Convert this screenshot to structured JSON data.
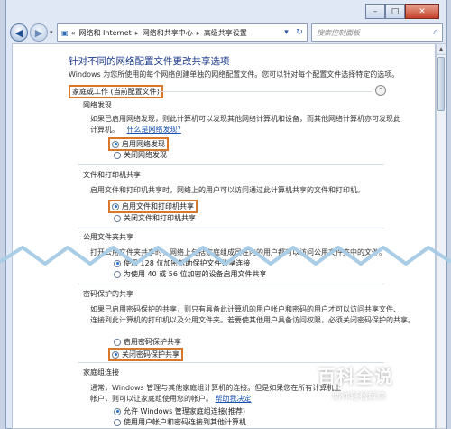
{
  "window": {
    "caption": {
      "minimize": "–",
      "maximize": "□",
      "close": "✕"
    }
  },
  "nav": {
    "back": "◀",
    "forward": "▶",
    "dropdown": "▾",
    "breadcrumbs": [
      "网络和 Internet",
      "网络和共享中心",
      "高级共享设置"
    ],
    "crumb_sep": "▸",
    "overflow": "«",
    "addr_dropdown": "▾",
    "refresh": "↻",
    "search_placeholder": "搜索控制面板",
    "search_icon": "magnifier-icon"
  },
  "page": {
    "title": "针对不同的网络配置文件更改共享选项",
    "description": "Windows 为您所使用的每个网络创建单独的网络配置文件。您可以针对每个配置文件选择特定的选项。",
    "group_label": "家庭或工作 (当前配置文件)",
    "group_chevron": "⌃",
    "sections": {
      "discovery": {
        "heading": "网络发现",
        "text1": "如果已启用网络发现，则此计算机可以发现其他网络计算机和设备，而其他网络计算机亦可发现此",
        "text2": "计算机。",
        "link": "什么是网络发现?",
        "options": [
          "启用网络发现",
          "关闭网络发现"
        ],
        "selected": 0
      },
      "file_printer": {
        "heading": "文件和打印机共享",
        "text": "启用文件和打印机共享时，网络上的用户可以访问通过此计算机共享的文件和打印机。",
        "options": [
          "启用文件和打印机共享",
          "关闭文件和打印机共享"
        ],
        "selected": 0
      },
      "public": {
        "heading": "公用文件夹共享",
        "text": "打开公用文件夹共享时，网络上包括家庭组成员在内的用户都可以访问公用文件夹中的文件。",
        "opt1": "使用 128 位加密帮助保护文件共享连接",
        "opt2": "为使用 40 或 56 位加密的设备启用文件共享"
      },
      "password": {
        "heading": "密码保护的共享",
        "text1": "如果已启用密码保护的共享，则只有具备此计算机的用户帐户和密码的用户才可以访问共享文件、",
        "text2": "连接到此计算机的打印机以及公用文件夹。若要使其他用户具备访问权限，必须关闭密码保护的共享。",
        "options": [
          "启用密码保护共享",
          "关闭密码保护共享"
        ],
        "selected": 1
      },
      "homegroup": {
        "heading": "家庭组连接",
        "text1": "通常，Windows 管理与其他家庭组计算机的连接。但是如果您在所有计算机上",
        "text2": "帐户，则可以让家庭组使用您的帐户。",
        "link": "帮助我决定",
        "options": [
          "允许 Windows 管理家庭组连接(推荐)",
          "使用用户帐户和密码连接到其他计算机"
        ],
        "selected": 0
      }
    }
  },
  "watermark": {
    "big": "百科全说",
    "small": "助你轻松解决"
  },
  "colors": {
    "highlight": "#d9772a",
    "title": "#1b3a8a",
    "link": "#1a52b5",
    "wave": "#a9cde6"
  }
}
